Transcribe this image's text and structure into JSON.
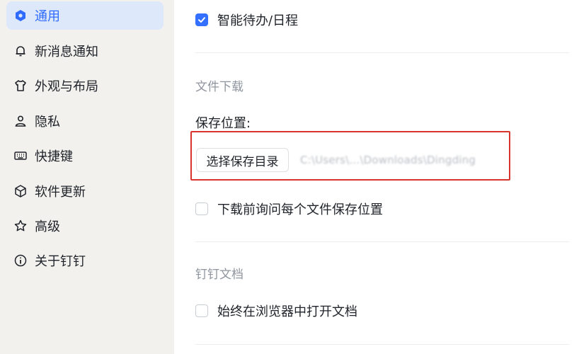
{
  "sidebar": {
    "items": [
      {
        "label": "通用",
        "icon": "hexagon-icon",
        "active": true
      },
      {
        "label": "新消息通知",
        "icon": "bell-icon"
      },
      {
        "label": "外观与布局",
        "icon": "tshirt-icon"
      },
      {
        "label": "隐私",
        "icon": "person-icon"
      },
      {
        "label": "快捷键",
        "icon": "keyboard-icon"
      },
      {
        "label": "软件更新",
        "icon": "cube-icon"
      },
      {
        "label": "高级",
        "icon": "star-icon"
      },
      {
        "label": "关于钉钉",
        "icon": "info-icon"
      }
    ]
  },
  "main": {
    "smart_todo": {
      "label": "智能待办/日程",
      "checked": true
    },
    "download": {
      "title": "文件下载",
      "save_location_label": "保存位置:",
      "choose_dir_button": "选择保存目录",
      "path": "C:\\Users\\...\\Downloads\\Dingding",
      "ask_each_file": {
        "label": "下载前询问每个文件保存位置",
        "checked": false
      }
    },
    "docs": {
      "title": "钉钉文档",
      "open_in_browser": {
        "label": "始终在浏览器中打开文档",
        "checked": false
      }
    }
  },
  "colors": {
    "accent": "#3370ff",
    "active_bg": "#dde8fb",
    "highlight_border": "#d8352f",
    "sidebar_bg": "#f2f1ee"
  }
}
